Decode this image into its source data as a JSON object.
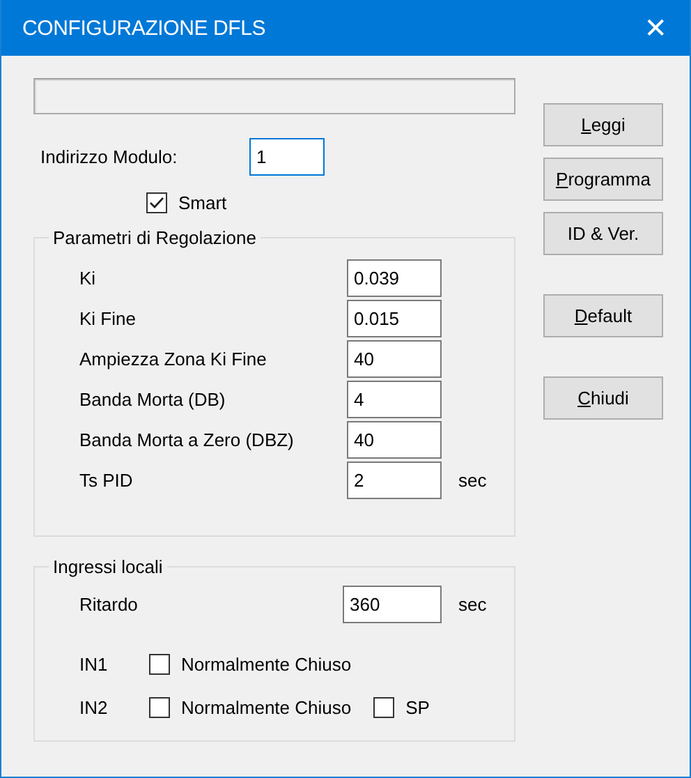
{
  "window": {
    "title": "CONFIGURAZIONE DFLS",
    "close": "✕"
  },
  "module_address": {
    "label": "Indirizzo Modulo:",
    "value": "1",
    "focused": true
  },
  "smart": {
    "label": "Smart",
    "checked": true
  },
  "regulation": {
    "title": "Parametri di Regolazione",
    "rows": [
      {
        "label": "Ki",
        "value": "0.039"
      },
      {
        "label": "Ki Fine",
        "value": "0.015"
      },
      {
        "label": "Ampiezza Zona Ki Fine",
        "value": "40"
      },
      {
        "label": "Banda Morta (DB)",
        "value": "4"
      },
      {
        "label": "Banda Morta a Zero (DBZ)",
        "value": "40"
      },
      {
        "label": "Ts PID",
        "value": "2",
        "unit": "sec"
      }
    ]
  },
  "local_inputs": {
    "title": "Ingressi locali",
    "delay": {
      "label": "Ritardo",
      "value": "360",
      "unit": "sec"
    },
    "inputs": [
      {
        "label": "IN1",
        "options": [
          {
            "label": "Normalmente Chiuso",
            "checked": false
          }
        ]
      },
      {
        "label": "IN2",
        "options": [
          {
            "label": "Normalmente Chiuso",
            "checked": false
          },
          {
            "label": "SP",
            "checked": false
          }
        ]
      }
    ]
  },
  "button_groups": [
    {
      "buttons": [
        {
          "label": "Leggi",
          "access_key": true
        },
        {
          "label": "Programma",
          "access_key": true
        },
        {
          "label": "ID & Ver.",
          "access_key": false
        }
      ]
    },
    {
      "buttons": [
        {
          "label": "Default",
          "access_key": true
        }
      ]
    },
    {
      "buttons": [
        {
          "label": "Chiudi",
          "access_key": true
        }
      ]
    }
  ]
}
